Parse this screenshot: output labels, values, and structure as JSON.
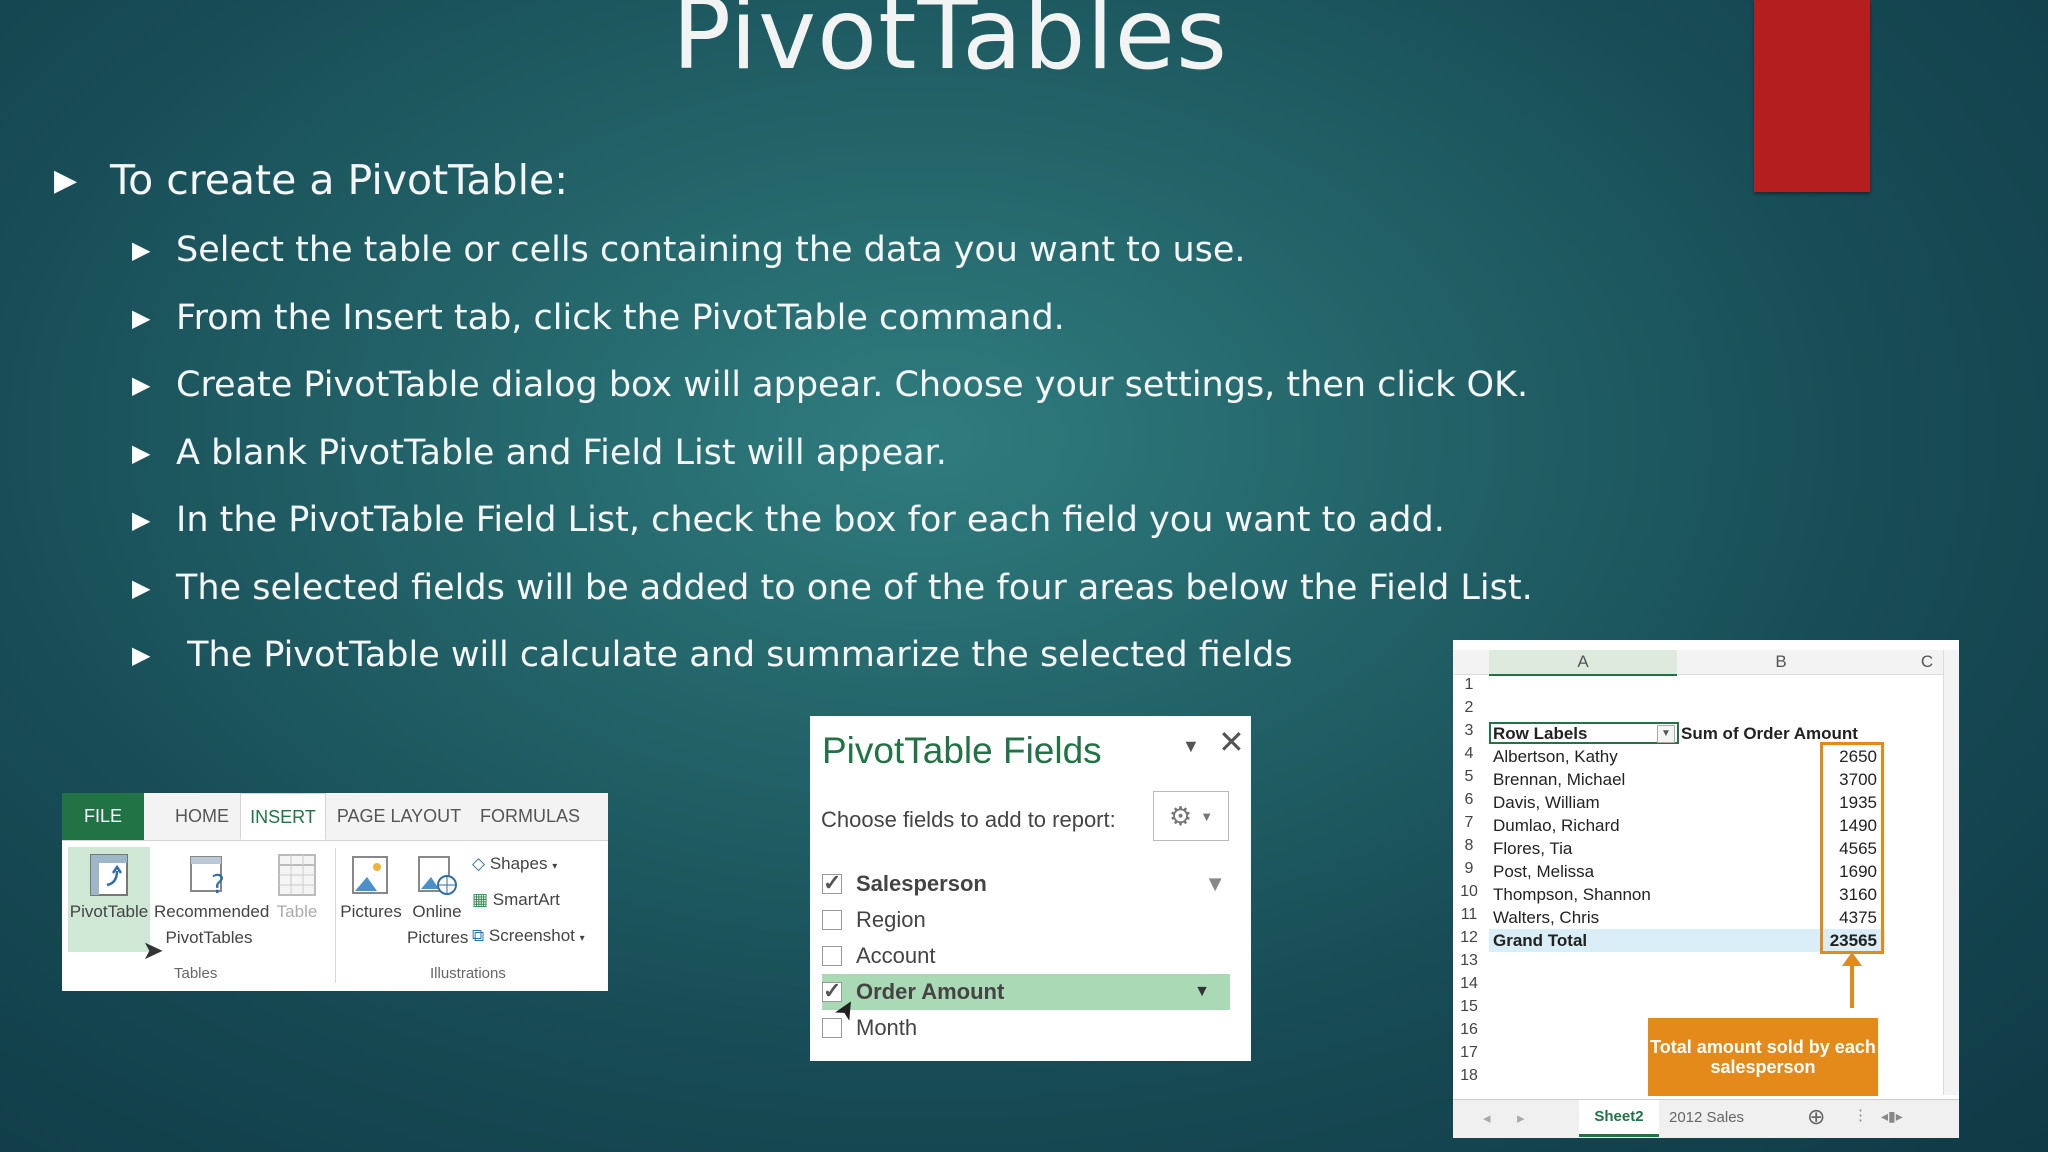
{
  "slide": {
    "title": "PivotTables",
    "heading": "To create a PivotTable:",
    "steps": [
      "Select the table or cells containing the data you want to use.",
      "From the Insert tab, click the PivotTable command.",
      "Create PivotTable dialog box will appear. Choose your settings, then click OK.",
      "A blank PivotTable and Field List will appear.",
      "In the PivotTable Field List, check the box for each field you want to add.",
      "The selected fields will be added to one of the four areas below the Field List.",
      " The PivotTable will calculate and summarize the selected fields"
    ],
    "accent_color": "#b51e1e"
  },
  "ribbon": {
    "tabs": [
      "FILE",
      "HOME",
      "INSERT",
      "PAGE LAYOUT",
      "FORMULAS"
    ],
    "active_tab": "INSERT",
    "buttons": {
      "pivottable": "PivotTable",
      "recommended_1": "Recommended",
      "recommended_2": "PivotTables",
      "table": "Table",
      "pictures": "Pictures",
      "online_1": "Online",
      "online_2": "Pictures",
      "shapes": "Shapes",
      "smartart": "SmartArt",
      "screenshot": "Screenshot"
    },
    "groups": {
      "tables": "Tables",
      "illustrations": "Illustrations"
    }
  },
  "field_list": {
    "title": "PivotTable Fields",
    "subtitle": "Choose fields to add to report:",
    "fields": [
      {
        "label": "Salesperson",
        "checked": true
      },
      {
        "label": "Region",
        "checked": false
      },
      {
        "label": "Account",
        "checked": false
      },
      {
        "label": "Order Amount",
        "checked": true
      },
      {
        "label": "Month",
        "checked": false
      }
    ]
  },
  "spreadsheet": {
    "columns": [
      "A",
      "B",
      "C"
    ],
    "row_numbers": [
      "1",
      "2",
      "3",
      "4",
      "5",
      "6",
      "7",
      "8",
      "9",
      "10",
      "11",
      "12",
      "13",
      "14",
      "15",
      "16",
      "17",
      "18"
    ],
    "header_a": "Row Labels",
    "header_b": "Sum of Order Amount",
    "rows": [
      {
        "name": "Albertson, Kathy",
        "value": "2650"
      },
      {
        "name": "Brennan, Michael",
        "value": "3700"
      },
      {
        "name": "Davis, William",
        "value": "1935"
      },
      {
        "name": "Dumlao, Richard",
        "value": "1490"
      },
      {
        "name": "Flores, Tia",
        "value": "4565"
      },
      {
        "name": "Post, Melissa",
        "value": "1690"
      },
      {
        "name": "Thompson, Shannon",
        "value": "3160"
      },
      {
        "name": "Walters, Chris",
        "value": "4375"
      }
    ],
    "grand_total_label": "Grand Total",
    "grand_total_value": "23565",
    "callout": "Total amount sold by each salesperson",
    "sheet_tabs": [
      "Sheet2",
      "2012 Sales"
    ],
    "callout_color": "#e38a1b"
  }
}
